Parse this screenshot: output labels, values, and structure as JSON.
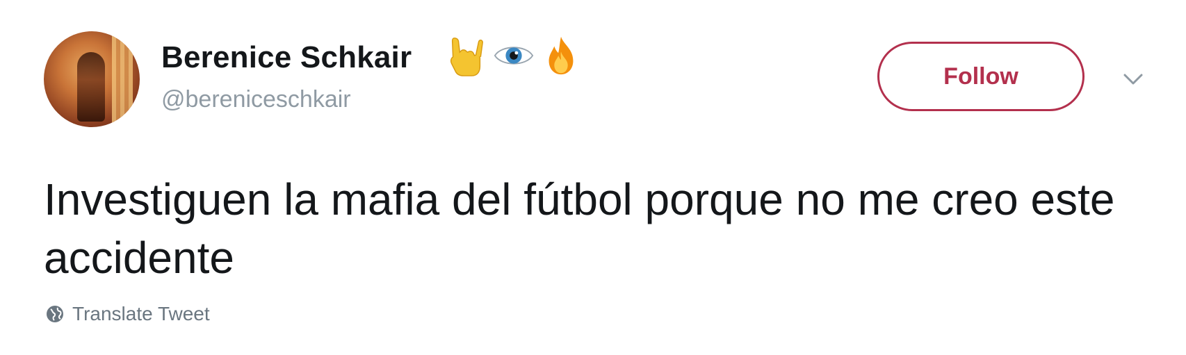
{
  "tweet": {
    "author": {
      "display_name": "Berenice Schkair",
      "handle": "@bereniceschkair",
      "name_emojis": [
        "sign-of-horns-emoji",
        "eye-emoji",
        "fire-emoji"
      ]
    },
    "follow_label": "Follow",
    "text": "Investiguen la mafia del fútbol porque no me creo este accidente",
    "translate_label": "Translate Tweet"
  },
  "colors": {
    "follow_accent": "#b3304d",
    "name_text": "#14171a",
    "handle_text": "#8f9aa3",
    "secondary_text": "#6a7680"
  },
  "icons": {
    "more": "chevron-down-icon",
    "translate": "globe-icon"
  }
}
